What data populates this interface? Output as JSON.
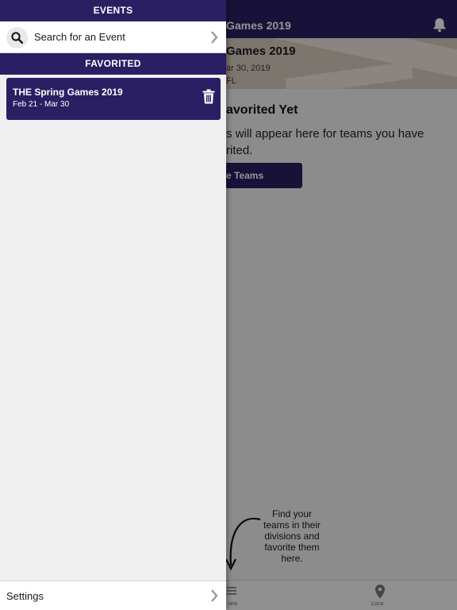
{
  "background": {
    "header_title": "Games 2019",
    "event_name": "Games 2019",
    "event_dates": "ar 30, 2019",
    "event_location": "FL",
    "empty_title": "avorited Yet",
    "empty_text": "s will appear here for teams you have rited.",
    "teams_button_label": "e Teams",
    "hint_text": "Find your teams in their divisions and favorite them here.",
    "tabs": [
      {
        "label": "ons",
        "icon": "list-icon"
      },
      {
        "label": "Loca",
        "icon": "location-pin-icon"
      }
    ]
  },
  "drawer": {
    "events_header": "EVENTS",
    "search_label": "Search for an Event",
    "favorited_header": "FAVORITED",
    "favorites": [
      {
        "title": "THE Spring Games 2019",
        "dates": "Feb 21 - Mar 30"
      }
    ],
    "settings_label": "Settings"
  },
  "colors": {
    "brand": "#2a1f63",
    "drawer_background": "#efefef"
  }
}
